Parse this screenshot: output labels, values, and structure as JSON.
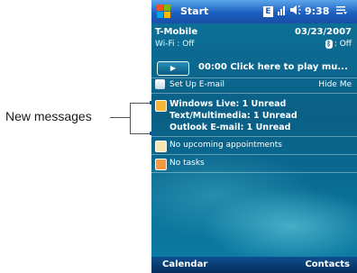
{
  "callout": {
    "label": "New messages"
  },
  "titlebar": {
    "title": "Start",
    "time": "9:38"
  },
  "today": {
    "carrier": "T-Mobile",
    "date": "03/23/2007",
    "wifi": "Wi-Fi : Off",
    "bluetooth": ": Off",
    "player_text": "00:00  Click here to play mu...",
    "setup_email": "Set Up E-mail",
    "hide_me": "Hide Me",
    "messages": [
      "Windows Live: 1 Unread",
      "Text/Multimedia: 1 Unread",
      "Outlook E-mail: 1 Unread"
    ],
    "appointments": "No upcoming appointments",
    "tasks": "No tasks"
  },
  "softkeys": {
    "left": "Calendar",
    "right": "Contacts"
  },
  "colors": {
    "titlebar": "#1c5fbf",
    "today_bg": "#0a5f85",
    "softbar": "#062d58"
  },
  "icons": [
    "windows-start-icon",
    "edge-icon",
    "signal-icon",
    "volume-icon",
    "menu-icon",
    "bluetooth-icon",
    "play-icon",
    "email-icon",
    "messaging-icon",
    "calendar-icon",
    "tasks-icon",
    "battery-icon"
  ]
}
